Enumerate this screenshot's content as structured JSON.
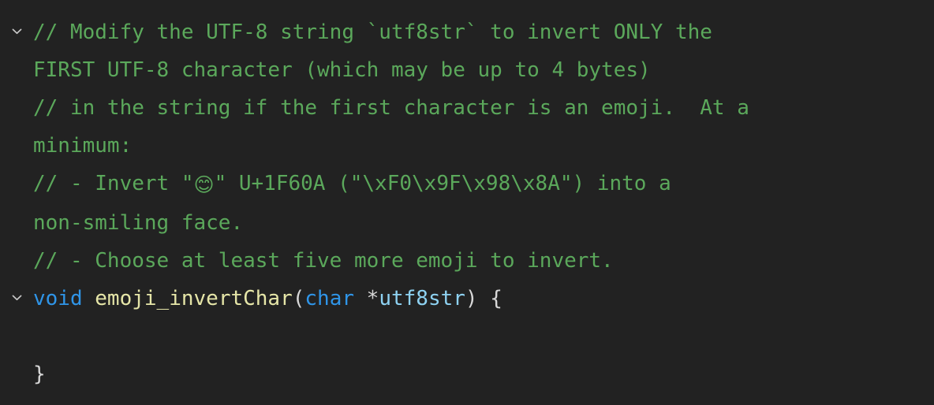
{
  "editor": {
    "background_color": "#222222",
    "language": "c",
    "comment_color": "#5ba85b",
    "keyword_color": "#2f95e8",
    "function_color": "#e6e6a8",
    "variable_color": "#8ed2f2",
    "plain_color": "#d8d8d8",
    "fold_icon": "chevron-down-icon"
  },
  "lines": [
    {
      "id": "line-1",
      "foldable": true,
      "segments": [
        {
          "type": "comment",
          "text": "// Modify the UTF-8 string `utf8str` to invert ONLY the"
        }
      ]
    },
    {
      "id": "line-1-wrap",
      "foldable": false,
      "segments": [
        {
          "type": "comment",
          "text": "FIRST UTF-8 character (which may be up to 4 bytes)"
        }
      ]
    },
    {
      "id": "line-2",
      "foldable": false,
      "segments": [
        {
          "type": "comment",
          "text": "// in the string if the first character is an emoji.  At a"
        }
      ]
    },
    {
      "id": "line-2-wrap",
      "foldable": false,
      "segments": [
        {
          "type": "comment",
          "text": "minimum:"
        }
      ]
    },
    {
      "id": "line-3",
      "foldable": false,
      "segments": [
        {
          "type": "comment",
          "text": "// - Invert \""
        },
        {
          "type": "emoji",
          "text": "😊"
        },
        {
          "type": "comment",
          "text": "\" U+1F60A (\"\\xF0\\x9F\\x98\\x8A\") into a"
        }
      ]
    },
    {
      "id": "line-3-wrap",
      "foldable": false,
      "segments": [
        {
          "type": "comment",
          "text": "non-smiling face."
        }
      ]
    },
    {
      "id": "line-4",
      "foldable": false,
      "segments": [
        {
          "type": "comment",
          "text": "// - Choose at least five more emoji to invert."
        }
      ]
    },
    {
      "id": "line-5",
      "foldable": true,
      "segments": [
        {
          "type": "keyword",
          "text": "void"
        },
        {
          "type": "plain",
          "text": " "
        },
        {
          "type": "function",
          "text": "emoji_invertChar"
        },
        {
          "type": "plain",
          "text": "("
        },
        {
          "type": "keyword",
          "text": "char"
        },
        {
          "type": "plain",
          "text": " *"
        },
        {
          "type": "variable",
          "text": "utf8str"
        },
        {
          "type": "plain",
          "text": ") {"
        }
      ]
    },
    {
      "id": "line-6",
      "foldable": false,
      "blank": true,
      "segments": []
    },
    {
      "id": "line-7",
      "foldable": false,
      "segments": [
        {
          "type": "plain",
          "text": "}"
        }
      ]
    }
  ]
}
